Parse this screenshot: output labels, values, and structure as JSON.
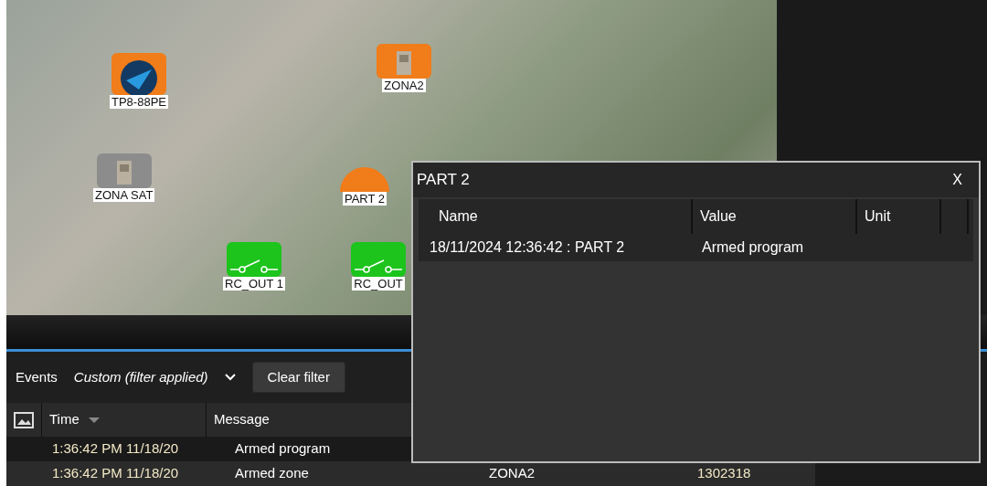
{
  "map": {
    "markers": [
      {
        "label": "TP8-88PE",
        "kind": "panel",
        "color": "#f07c1a"
      },
      {
        "label": "ZONA2",
        "kind": "zone",
        "color": "#f07c1a"
      },
      {
        "label": "ZONA SAT",
        "kind": "zone",
        "color": "#8c8c8c"
      },
      {
        "label": "PART 2",
        "kind": "partition",
        "color": "#f07c1a"
      },
      {
        "label": "RC_OUT 1",
        "kind": "output",
        "color": "#1cc41c"
      },
      {
        "label": "RC_OUT",
        "kind": "output",
        "color": "#1cc41c"
      }
    ]
  },
  "events": {
    "label": "Events",
    "filter": "Custom (filter applied)",
    "clear_button": "Clear filter",
    "columns": [
      "Time",
      "Message"
    ],
    "rows": [
      {
        "time": "1:36:42 PM 11/18/20",
        "message": "Armed program",
        "selected": true
      },
      {
        "time": "1:36:42 PM 11/18/20",
        "message": "Armed zone",
        "column_3": "ZONA2",
        "column_4": "1302318",
        "selected": false
      }
    ]
  },
  "dialog": {
    "title": "PART 2",
    "close": "X",
    "columns": [
      "Name",
      "Value",
      "Unit"
    ],
    "rows": [
      {
        "name": "18/11/2024 12:36:42 : PART 2",
        "value": "Armed program"
      }
    ]
  }
}
